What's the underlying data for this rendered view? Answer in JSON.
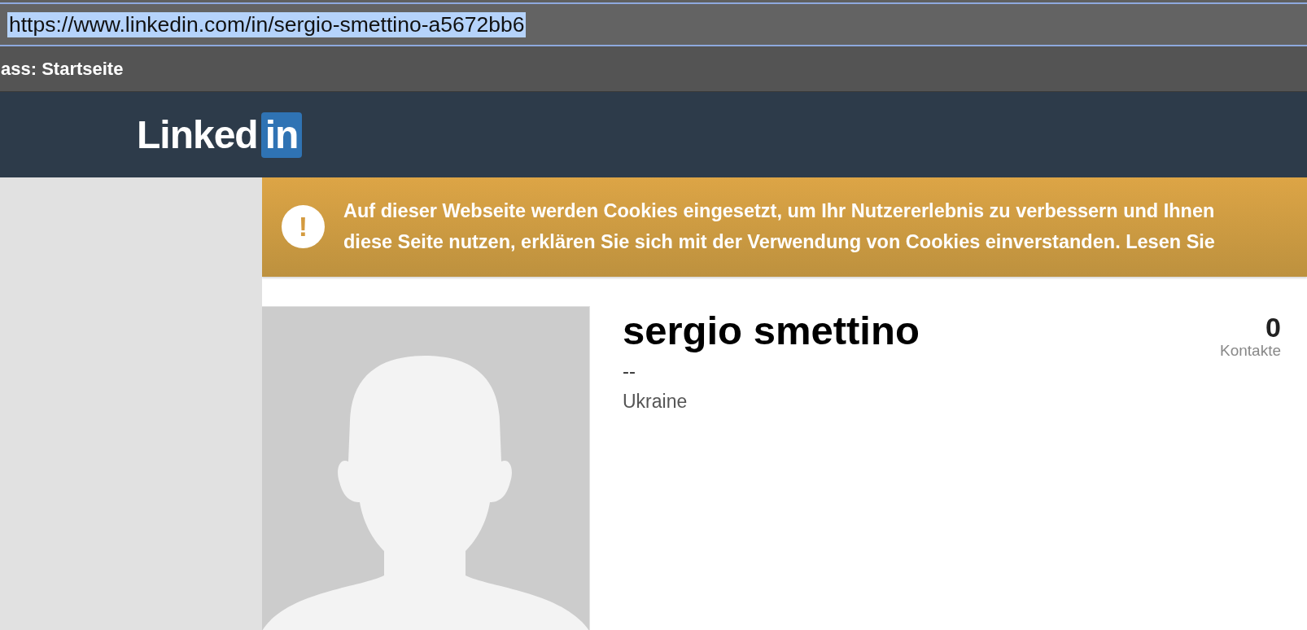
{
  "address_bar": {
    "url": "https://www.linkedin.com/in/sergio-smettino-a5672bb6",
    "selected": true
  },
  "tab_bar": {
    "title": "ass: Startseite"
  },
  "header": {
    "logo": {
      "word": "Linked",
      "badge": "in"
    }
  },
  "cookie_banner": {
    "icon": "!",
    "lines": [
      "Auf dieser Webseite werden Cookies eingesetzt, um Ihr Nutzererlebnis zu verbessern und Ihnen",
      "diese Seite nutzen, erklären Sie sich mit der Verwendung von Cookies einverstanden. Lesen Sie"
    ]
  },
  "profile": {
    "name": "sergio smettino",
    "headline": "--",
    "location": "Ukraine",
    "connections": {
      "count": "0",
      "label": "Kontakte"
    }
  }
}
